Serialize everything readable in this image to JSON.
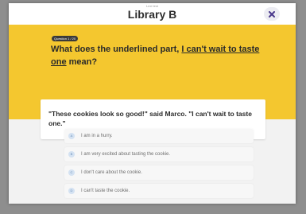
{
  "header": {
    "subtitle": "Lexi test",
    "title": "Library B",
    "close_icon": "x-icon"
  },
  "question": {
    "counter": "Question 1 / 20",
    "prompt_prefix": "What does the underlined part, ",
    "prompt_underlined": "I can't wait to taste one",
    "prompt_suffix": " mean?"
  },
  "passage": "\"These cookies look so good!\" said Marco. \"I can't wait to taste one.\"",
  "options": [
    {
      "letter": "A",
      "label": "I am in a hurry."
    },
    {
      "letter": "B",
      "label": "I am very excited about tasting the cookie."
    },
    {
      "letter": "C",
      "label": "I don't care about the cookie."
    },
    {
      "letter": "D",
      "label": "I can't taste the cookie."
    }
  ],
  "colors": {
    "accent": "#f4c72f",
    "backdrop": "#8e8e8e",
    "close_x": "#4b3a8c"
  }
}
